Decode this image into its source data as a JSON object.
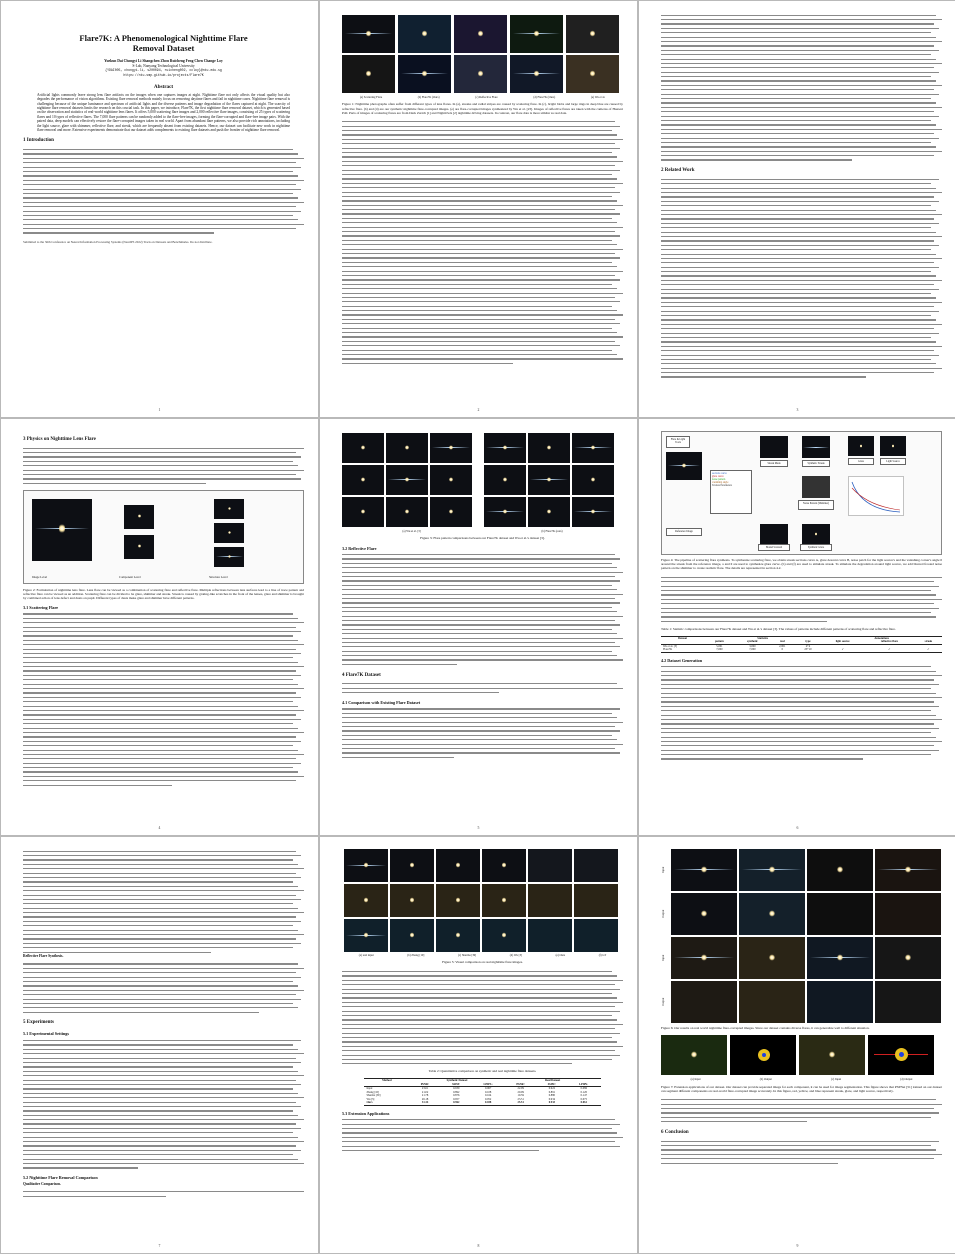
{
  "paper": {
    "title_line1": "Flare7K: A Phenomenological Nighttime Flare",
    "title_line2": "Removal Dataset",
    "authors": "Yuekun Dai   Chongyi Li   Shangchen Zhou   Ruicheng Feng   Chen Change Loy",
    "affiliation": "S-Lab, Nanyang Technological University",
    "emails": "{YDAI005, chongyi.li, s200094, ruicheng002, ccloy}@ntu.edu.sg",
    "url": "https://ntu-smp.github.io/projects/Flare7K",
    "abstract_heading": "Abstract",
    "abstract": "Artificial lights commonly leave strong lens flare artifacts on the images when one captures images at night. Nighttime flare not only affects the visual quality but also degrades the performance of vision algorithms. Existing flare removal methods mainly focus on removing daytime flares and fail in nighttime cases. Nighttime flare removal is challenging because of the unique luminance and spectrum of artificial lights and the diverse patterns and image degradation of the flares captured at night. The scarcity of nighttime flare removal datasets limits the research on this crucial task. In this paper, we introduce, Flare7K, the first nighttime flare removal dataset, which is generated based on the observation and statistics of real-world nighttime lens flares. It offers 5,000 scattering flare images and 2,000 reflective flare images, consisting of 25 types of scattering flares and 10 types of reflective flares. The 7,000 flare patterns can be randomly added to the flare-free images, forming the flare-corrupted and flare-free image pairs. With the paired data, deep models can effectively restore the flare-corrupted images taken in real world. Apart from abundant flare patterns, we also provide rich annotations, including the light source, glare with shimmer, reflective flare, and streak, which are frequently absent from existing datasets. Hence, our dataset can facilitate new work in nighttime flare removal and more. Extensive experiments demonstrate that our dataset adds complements to existing flare datasets and push the frontier of nighttime flare removal.",
    "footnote": "Submitted to the 36th Conference on Neural Information Processing Systems (NeurIPS 2022) Track on Datasets and Benchmarks. Do not distribute."
  },
  "pages": [
    {
      "number": "1",
      "sections": [
        "1   Introduction"
      ]
    },
    {
      "number": "2",
      "figure_caption": "Figure 1: Nighttime photographs often suffer from different types of lens flares. In (a), streaks and radial stripes are caused by scattering flare. In (c), bright blobs and large rings in deep blue are caused by reflective flare. (b) and (d) are our synthetic nighttime flare-corrupted images. (e) are flare-corrupted images synthesized by Wu et al. [23]. Images of reflective flares are taken with the cameras of Huawei P40. Parts of images of scattering flares are from Dark Zurich [1] and NightOwls [2] nighttime driving datasets. In contrast, our flare data is more similar as real data.",
      "subcaptions": [
        "(a) Scattering Flare",
        "(b) Flare7K (Ours)",
        "(c) Reflective Flare",
        "(d) Flare7K (Ours)",
        "(e) Wu et al."
      ]
    },
    {
      "number": "3",
      "sections": [
        "2   Related Work"
      ],
      "bold_runs": [
        "Lens Flare Dataset.",
        "Single Image Flare Removal."
      ]
    },
    {
      "number": "4",
      "sections": [
        "3   Physics on Nighttime Lens Flare"
      ],
      "subsections": [
        "3.1   Scattering Flare"
      ],
      "figure_caption": "Figure 2: Formulation of nighttime lens flare. Lens flare can be viewed as a combination of scattering flare and reflective flare. Multiple reflections between lens surfaces lead to a line of trace pattern and reflective flare can be viewed as an addition. Scattering flare can be divided to be glare, shimmer and streak. Streak is caused by grating-like scratches in the front of the lenses, glare and shimmer is brought by combined action of lens defect and dusts on pupil. Different types of dusts make glare and shimmer have different patterns.",
      "diagram_labels": [
        "Image Level",
        "Component Level",
        "Structure Level"
      ]
    },
    {
      "number": "5",
      "subsections": [
        "3.2   Reflective Flare"
      ],
      "sections": [
        "4   Flare7K Dataset"
      ],
      "subsections2": [
        "4.1   Comparison with Existing Flare Dataset"
      ],
      "figure_caption": "Figure 3: Flare pattern comparisons between our Flare7K dataset and Wu et al.'s dataset [3].",
      "subcaptions": [
        "(a) Wu et al. [3]",
        "(b) Flare7K (ours)"
      ]
    },
    {
      "number": "6",
      "subsections": [
        "4.2   Dataset Generation"
      ],
      "figure_caption": "Figure 4: The pipeline of scattering flare synthesis. To synthesize scattering flare, we obtain streak sections curve A, glare descent curve B, noise patch for the light source's and the vanishing corner's angle θ around the streak from the reference image, a and θ are used to synthesize glare curve. (b) and (f) are used to simulate streak. To simulate the degradation around light source, we add blurred frosted noise pattern on the shimmer to create realistic flare. The details are represented in section 4.2.",
      "table_caption": "Table 1: Statistic comparisons between our Flare7K dataset and Wu et al.'s dataset [3]. The values of patterns include different patterns of scattering flare and reflective flare.",
      "diagram_labels": [
        "Flare & Light Tools",
        "Streak Mask",
        "Synthetic Streak",
        "Glare",
        "Light Source",
        "Reference Image",
        "Noise Pattern (Shimmer)",
        "Bound Scatterd",
        "Synthetic Glare"
      ],
      "legend": [
        "sections curve",
        "glare curve",
        "noise pattern",
        "vanishing angle",
        "Texture Parameters"
      ],
      "table": {
        "headers_top": [
          "Dataset",
          "Statistics",
          "Annotations"
        ],
        "headers": [
          "",
          "pattern",
          "synthetic",
          "real",
          "type",
          "light source",
          "reflective flare",
          "streak"
        ],
        "rows": [
          [
            "Wu et al. [3]",
            "5,001",
            "3,000",
            "2,001",
            "2+4",
            "",
            "",
            ""
          ],
          [
            "Flare7K",
            "7,000",
            "7,000",
            "0",
            "25+10",
            "✓",
            "✓",
            "✓"
          ]
        ]
      }
    },
    {
      "number": "7",
      "sections": [
        "5   Experiments"
      ],
      "subsections": [
        "5.1   Experimental Settings",
        "5.2   Nighttime Flare Removal Comparison"
      ],
      "bold_runs": [
        "Reflective Flare Synthesis.",
        "Qualitative Comparison."
      ]
    },
    {
      "number": "8",
      "subsections": [
        "5.3   Extension Applications"
      ],
      "figure_caption": "Figure 5: Visual comparison on real nighttime flare images.",
      "subcaptions": [
        "(a) real input",
        "(b) Zhang [10]",
        "(c) Sharma [39]",
        "(d) Wu [3]",
        "(e) Ours",
        "(f) GT"
      ],
      "table_caption": "Table 2: Quantitative comparison on synthetic and real nighttime flare datasets.",
      "table": {
        "headers_top": [
          "Method",
          "Synthetic Dataset",
          "Real Dataset"
        ],
        "headers": [
          "",
          "PSNR↑",
          "SSIM↑",
          "LPIPS↓",
          "PSNR↑",
          "SSIM↑",
          "LPIPS↓"
        ],
        "rows": [
          [
            "Input",
            "23.61",
            "0.939",
            "0.067",
            "22.09",
            "0.922",
            "0.086"
          ],
          [
            "Zhang [10]",
            "21.02",
            "0.892",
            "0.108",
            "20.09",
            "0.891",
            "0.120"
          ],
          [
            "Sharma [39]",
            "21.78",
            "0.876",
            "0.164",
            "19.59",
            "0.880",
            "0.147"
          ],
          [
            "Wu [3]",
            "26.18",
            "0.957",
            "0.052",
            "23.51",
            "0.934",
            "0.075"
          ],
          [
            "Ours",
            "31.34",
            "0.962",
            "0.038",
            "25.51",
            "0.933",
            "0.061"
          ]
        ]
      }
    },
    {
      "number": "9",
      "sections": [
        "6   Conclusion"
      ],
      "figure_caption": "Figure 6: Our results on real world nighttime flare-corrupted images. Since our dataset contains diverse flares, it can generalize well to different situation.",
      "figure7_caption": "Figure 7: Extension applications of our dataset. Our dataset can provide separated image for each component, it can be used for image segmentation. This figure shows that PSPNet [51] trained on our dataset can segment different components on real-world flare-corrupted image accurately. In this figure, red, yellow, and blue represent streak, glare, and light source, respectively.",
      "row_labels": [
        "Input",
        "Output",
        "Input",
        "Output"
      ],
      "subcaptions": [
        "(a) Input",
        "(b) Output",
        "(c) Input",
        "(d) Output"
      ]
    }
  ],
  "colors": {
    "page_bg": "#ffffff",
    "viewer_bg": "#b9b9b9",
    "night_sky": "#0d0f14",
    "text": "#111111"
  }
}
